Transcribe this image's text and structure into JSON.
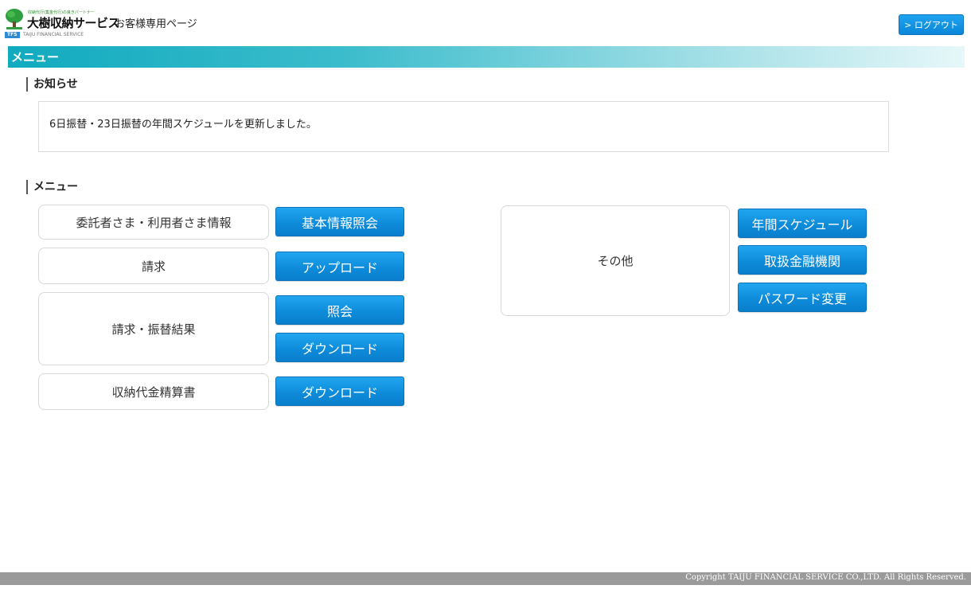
{
  "header": {
    "logo_tagline": "収納代行(集金代行)の良きパートナー",
    "logo_name": "大樹収納サービス",
    "logo_badge": "TFS",
    "logo_en": "TAIJU FINANCIAL SERVICE",
    "page_label": "お客様専用ページ",
    "logout_label": "> ログアウト"
  },
  "menu_band": {
    "title": "メニュー"
  },
  "notice": {
    "heading": "お知らせ",
    "text": "6日振替・23日振替の年間スケジュールを更新しました。"
  },
  "menu": {
    "heading": "メニュー",
    "client_info": {
      "label": "委託者さま・利用者さま情報",
      "button": "基本情報照会"
    },
    "billing": {
      "label": "請求",
      "button": "アップロード"
    },
    "billing_result": {
      "label": "請求・振替結果",
      "button_inquiry": "照会",
      "button_download": "ダウンロード"
    },
    "settlement": {
      "label": "収納代金精算書",
      "button": "ダウンロード"
    },
    "other": {
      "label": "その他",
      "button_schedule": "年間スケジュール",
      "button_banks": "取扱金融機関",
      "button_password": "パスワード変更"
    }
  },
  "footer": {
    "copyright": "Copyright TAIJU FINANCIAL SERVICE CO.,LTD. All Rights Reserved."
  },
  "colors": {
    "accent_blue": "#0d8ad9",
    "band_teal": "#11aabf",
    "footer_gray": "#9a9a9a"
  }
}
